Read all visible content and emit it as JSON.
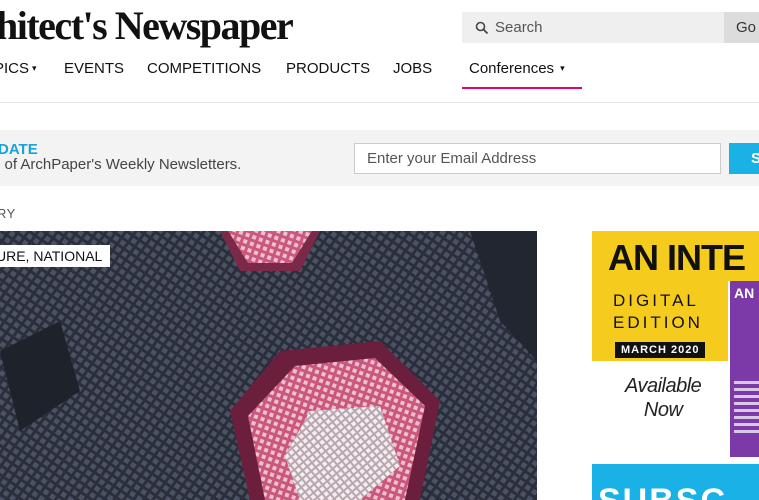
{
  "header": {
    "logo_text": "hitect's Newspaper",
    "search_placeholder": "Search",
    "go_label": "Go"
  },
  "nav": {
    "items": [
      {
        "label": "PICS",
        "has_caret": true
      },
      {
        "label": "EVENTS"
      },
      {
        "label": "COMPETITIONS"
      },
      {
        "label": "PRODUCTS"
      },
      {
        "label": "JOBS"
      }
    ],
    "conferences_label": "Conferences",
    "caret": "▾"
  },
  "newsletter": {
    "title": "DATE",
    "subtitle": "e of ArchPaper's Weekly Newsletters.",
    "email_placeholder": "Enter your Email Address",
    "submit_label": "S"
  },
  "section": {
    "label": "RY"
  },
  "feature": {
    "category": "URE, NATIONAL"
  },
  "ad": {
    "title": "AN INTE",
    "line1": "DIGITAL",
    "line2": "EDITION",
    "date": "MARCH 2020",
    "available_line1": "Available",
    "available_line2": "Now",
    "magazine_title": "AN I"
  },
  "subscribe": {
    "label": "SUBSC"
  },
  "colors": {
    "accent_pink": "#e2007a",
    "accent_blue": "#1ab2e6",
    "ad_yellow": "#f5cb1d",
    "magazine_purple": "#7c3aa8"
  }
}
